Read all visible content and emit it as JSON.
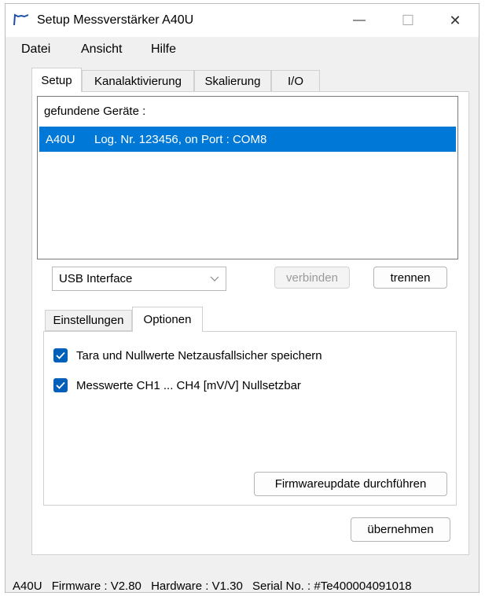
{
  "window": {
    "title": "Setup Messverstärker A40U",
    "minimize_glyph": "—",
    "maximize_glyph": "☐",
    "close_glyph": "✕"
  },
  "menu": [
    "Datei",
    "Ansicht",
    "Hilfe"
  ],
  "main_tabs": [
    {
      "label": "Setup",
      "active": true
    },
    {
      "label": "Kanalaktivierung",
      "active": false
    },
    {
      "label": "Skalierung",
      "active": false
    },
    {
      "label": "I/O",
      "active": false
    }
  ],
  "devices": {
    "header": "gefundene Geräte :",
    "selected_row": {
      "device": "A40U",
      "info": "Log. Nr. 123456, on Port : COM8"
    }
  },
  "interface_select": {
    "value": "USB Interface"
  },
  "buttons": {
    "connect": "verbinden",
    "disconnect": "trennen",
    "firmware_update": "Firmwareupdate durchführen",
    "apply": "übernehmen"
  },
  "sub_tabs": [
    {
      "label": "Einstellungen",
      "active": false
    },
    {
      "label": "Optionen",
      "active": true
    }
  ],
  "options": [
    {
      "label": "Tara und Nullwerte Netzausfallsicher speichern",
      "checked": true
    },
    {
      "label": "Messwerte CH1 ... CH4 [mV/V] Nullsetzbar",
      "checked": true
    }
  ],
  "status": {
    "device": "A40U",
    "firmware": "Firmware : V2.80",
    "hardware": "Hardware : V1.30",
    "serial": "Serial No. : #Te400004091018"
  },
  "colors": {
    "selection": "#0078d7",
    "checkbox": "#005fb8"
  }
}
